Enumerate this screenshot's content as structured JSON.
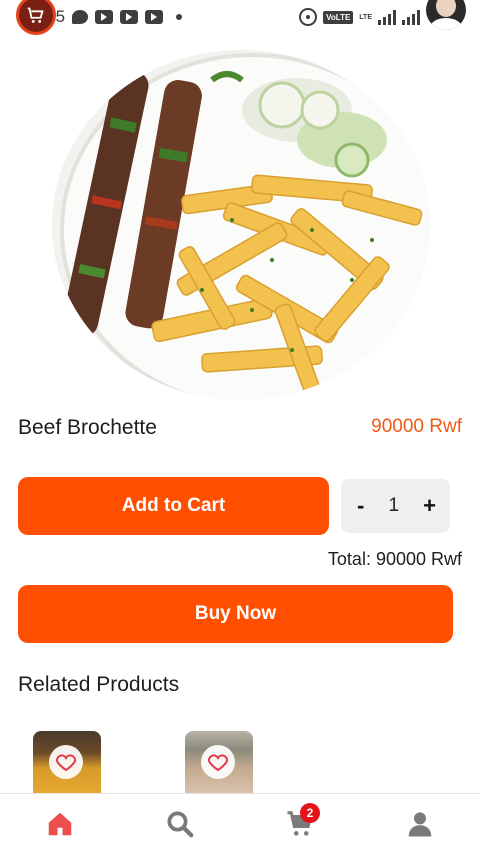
{
  "status_bar": {
    "time": "5:05",
    "network_badge": "VoLTE",
    "lte_label": "LTE"
  },
  "product": {
    "name": "Beef Brochette",
    "price": "90000 Rwf",
    "image_icon": "product-photo"
  },
  "cart_controls": {
    "add_to_cart_label": "Add to Cart",
    "decrement_label": "-",
    "quantity": "1",
    "increment_label": "+"
  },
  "total": "Total: 90000 Rwf",
  "buy_now_label": "Buy Now",
  "related": {
    "heading": "Related Products",
    "items": [
      {
        "icon": "heart-icon"
      },
      {
        "icon": "heart-icon"
      }
    ]
  },
  "bottom_nav": {
    "items": [
      {
        "id": "home",
        "icon": "home-icon",
        "active": true
      },
      {
        "id": "search",
        "icon": "search-icon",
        "active": false
      },
      {
        "id": "cart",
        "icon": "cart-icon",
        "active": false,
        "badge": "2"
      },
      {
        "id": "profile",
        "icon": "user-icon",
        "active": false
      }
    ]
  },
  "colors": {
    "accent": "#ff4f00",
    "price": "#f15a14",
    "active_nav": "#ec4d4d",
    "inactive_nav": "#7a7a7a",
    "badge": "#e6141a"
  }
}
